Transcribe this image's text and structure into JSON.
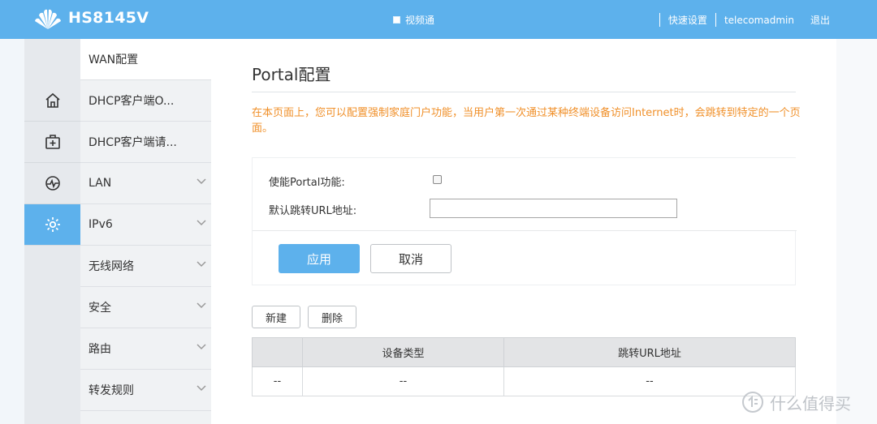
{
  "header": {
    "model": "HS8145V",
    "video_label": "视频通",
    "quick_setup": "快速设置",
    "username": "telecomadmin",
    "logout": "退出",
    "bg_color": "#5db1ec"
  },
  "rail": {
    "items": [
      {
        "icon": "home-icon"
      },
      {
        "icon": "medkit-icon"
      },
      {
        "icon": "monitor-icon"
      },
      {
        "icon": "gear-icon",
        "active": true
      }
    ]
  },
  "sidebar": {
    "items": [
      {
        "label": "WAN配置",
        "active": true
      },
      {
        "label": "DHCP客户端O..."
      },
      {
        "label": "DHCP客户端请..."
      },
      {
        "label": "LAN",
        "expandable": true
      },
      {
        "label": "IPv6",
        "expandable": true
      },
      {
        "label": "无线网络",
        "expandable": true
      },
      {
        "label": "安全",
        "expandable": true
      },
      {
        "label": "路由",
        "expandable": true
      },
      {
        "label": "转发规则",
        "expandable": true
      }
    ]
  },
  "main": {
    "title": "Portal配置",
    "description": "在本页面上，您可以配置强制家庭门户功能，当用户第一次通过某种终端设备访问Internet时，会跳转到特定的一个页面。",
    "form": {
      "enable_label": "使能Portal功能:",
      "enable_checked": false,
      "url_label": "默认跳转URL地址:",
      "url_value": ""
    },
    "apply_button": "应用",
    "cancel_button": "取消",
    "new_button": "新建",
    "delete_button": "删除",
    "table": {
      "headers": [
        "",
        "设备类型",
        "跳转URL地址"
      ],
      "rows": [
        [
          "--",
          "--",
          "--"
        ]
      ]
    }
  },
  "watermark": {
    "text": "什么值得买"
  }
}
